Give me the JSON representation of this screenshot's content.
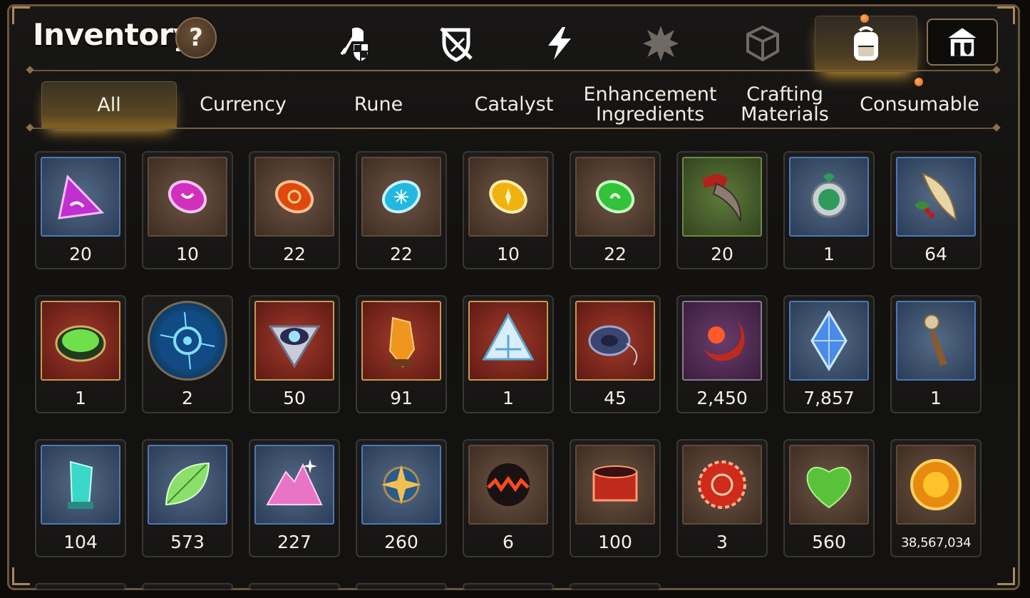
{
  "header": {
    "title": "Inventory",
    "help_label": "?"
  },
  "top_icons": [
    {
      "name": "equipment",
      "icon": "knight-helmet-sword-shield-icon"
    },
    {
      "name": "no-weapon",
      "icon": "crossed-sword-shield-icon"
    },
    {
      "name": "power",
      "icon": "lightning-bolt-icon"
    },
    {
      "name": "burst",
      "icon": "spiky-burst-icon"
    },
    {
      "name": "crate",
      "icon": "broken-cube-icon"
    },
    {
      "name": "backpack",
      "icon": "backpack-icon",
      "active": true
    },
    {
      "name": "guild-shop",
      "icon": "shop-building-icon"
    }
  ],
  "tabs": [
    {
      "label": "All",
      "active": true
    },
    {
      "label": "Currency"
    },
    {
      "label": "Rune"
    },
    {
      "label": "Catalyst"
    },
    {
      "label": "Enhancement Ingredients"
    },
    {
      "label": "Crafting Materials"
    },
    {
      "label": "Consumable"
    }
  ],
  "items": [
    {
      "count": "20",
      "icon": "purple-triangle-gem-icon",
      "frame": "blue"
    },
    {
      "count": "10",
      "icon": "pink-oval-gem-icon",
      "frame": "brown"
    },
    {
      "count": "22",
      "icon": "red-orange-oval-gem-icon",
      "frame": "brown"
    },
    {
      "count": "22",
      "icon": "cyan-snowflake-gem-icon",
      "frame": "brown"
    },
    {
      "count": "10",
      "icon": "yellow-oval-gem-icon",
      "frame": "brown"
    },
    {
      "count": "22",
      "icon": "green-oval-gem-icon",
      "frame": "brown"
    },
    {
      "count": "20",
      "icon": "red-claw-icon",
      "frame": "green"
    },
    {
      "count": "1",
      "icon": "green-compass-amulet-icon",
      "frame": "blue"
    },
    {
      "count": "64",
      "icon": "feather-berries-icon",
      "frame": "blue"
    },
    {
      "count": "1",
      "icon": "green-cauldron-icon",
      "frame": "red"
    },
    {
      "count": "2",
      "icon": "blue-rune-disc-icon",
      "frame": "circle"
    },
    {
      "count": "50",
      "icon": "all-seeing-eye-icon",
      "frame": "red"
    },
    {
      "count": "91",
      "icon": "orange-crystal-shard-icon",
      "frame": "red"
    },
    {
      "count": "1",
      "icon": "triquetra-pyramid-icon",
      "frame": "red"
    },
    {
      "count": "45",
      "icon": "blue-coil-icon",
      "frame": "red"
    },
    {
      "count": "2,450",
      "icon": "red-flower-crescent-icon",
      "frame": "purple"
    },
    {
      "count": "7,857",
      "icon": "blue-diamond-crystal-icon",
      "frame": "blue"
    },
    {
      "count": "1",
      "icon": "bronze-dagger-icon",
      "frame": "blue"
    },
    {
      "count": "104",
      "icon": "teal-crystal-pillar-icon",
      "frame": "blue"
    },
    {
      "count": "573",
      "icon": "green-leaf-icon",
      "frame": "blue"
    },
    {
      "count": "227",
      "icon": "pink-crystal-pile-icon",
      "frame": "blue"
    },
    {
      "count": "260",
      "icon": "gold-star-amulet-icon",
      "frame": "blue"
    },
    {
      "count": "6",
      "icon": "red-lava-orb-icon",
      "frame": "brown"
    },
    {
      "count": "100",
      "icon": "red-ring-band-icon",
      "frame": "brown"
    },
    {
      "count": "3",
      "icon": "red-bottle-cap-icon",
      "frame": "brown"
    },
    {
      "count": "560",
      "icon": "green-heart-icon",
      "frame": "brown"
    },
    {
      "count": "38,567,034",
      "icon": "gold-sun-coin-icon",
      "frame": "brown"
    }
  ],
  "colors": {
    "frame_border": "#6b5638",
    "active_glow": "#d9a238",
    "notification_dot": "#e2561a"
  }
}
